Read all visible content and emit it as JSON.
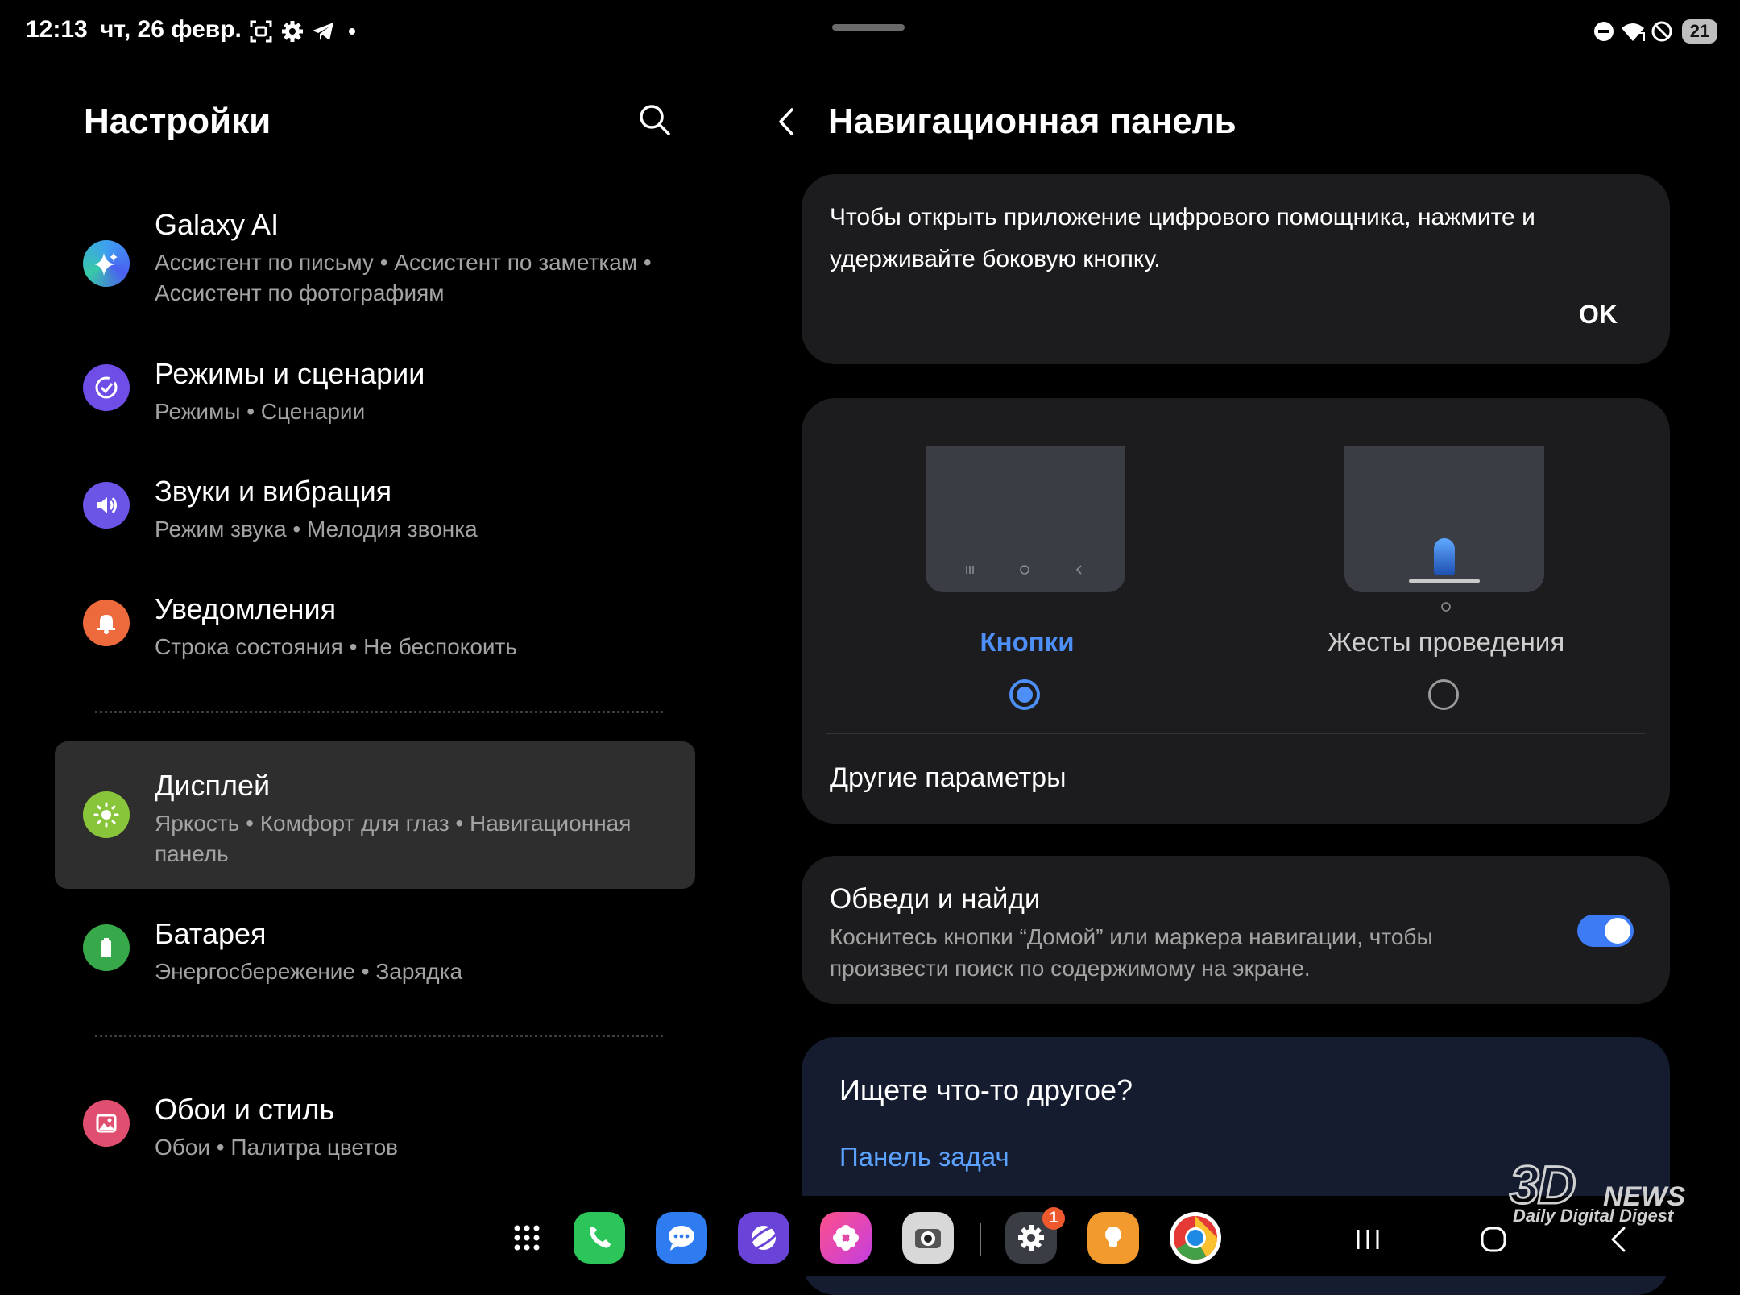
{
  "status_bar": {
    "time": "12:13",
    "date": "чт, 26 февр.",
    "left_icons": [
      "screenshot-icon",
      "settings-gear-icon",
      "telegram-icon",
      "dot-icon"
    ],
    "right_icons": [
      "do-not-disturb-icon",
      "wifi-icon",
      "no-sim-icon"
    ],
    "battery_level": "21"
  },
  "left_panel": {
    "title": "Настройки",
    "items": [
      {
        "title": "Galaxy AI",
        "subtitle": "Ассистент по письму  •  Ассистент по заметкам  •  Ассистент по фотографиям",
        "icon": "galaxy-ai-icon",
        "color": "#3a7bd5"
      },
      {
        "title": "Режимы и сценарии",
        "subtitle": "Режимы  •  Сценарии",
        "icon": "modes-icon",
        "color": "#6f4ee8"
      },
      {
        "title": "Звуки и вибрация",
        "subtitle": "Режим звука  •  Мелодия звонка",
        "icon": "sound-icon",
        "color": "#6a55e6"
      },
      {
        "title": "Уведомления",
        "subtitle": "Строка состояния  •  Не беспокоить",
        "icon": "bell-icon",
        "color": "#ec6a3b"
      },
      {
        "title": "Дисплей",
        "subtitle": "Яркость  •  Комфорт для глаз  •  Навигационная панель",
        "icon": "sun-icon",
        "color": "#88c53a",
        "selected": true
      },
      {
        "title": "Батарея",
        "subtitle": "Энергосбережение  •  Зарядка",
        "icon": "battery-icon",
        "color": "#37a94a"
      },
      {
        "title": "Обои и стиль",
        "subtitle": "Обои  •  Палитра цветов",
        "icon": "wallpaper-icon",
        "color": "#e14f70"
      }
    ]
  },
  "right_panel": {
    "title": "Навигационная панель",
    "info_text": "Чтобы открыть приложение цифрового помощника, нажмите и удерживайте боковую кнопку.",
    "ok_label": "OK",
    "options": [
      {
        "label": "Кнопки",
        "selected": true
      },
      {
        "label": "Жесты проведения",
        "selected": false
      }
    ],
    "other_params": "Другие параметры",
    "circle_search": {
      "title": "Обведи и найди",
      "description": "Коснитесь кнопки “Домой” или маркера навигации, чтобы произвести поиск по содержимому на экране.",
      "enabled": true
    },
    "suggest": {
      "title": "Ищете что-то другое?",
      "link": "Панель задач"
    }
  },
  "taskbar": {
    "apps": [
      "apps-grid-icon",
      "phone-icon",
      "messages-icon",
      "browser-icon",
      "gallery-icon",
      "camera-icon",
      "settings-icon",
      "tips-icon",
      "chrome-icon"
    ],
    "settings_badge": "1",
    "nav": [
      "recents-icon",
      "home-icon",
      "back-icon"
    ]
  },
  "watermark": {
    "logo": "3D",
    "news": "NEWS",
    "tagline": "Daily Digital Digest"
  }
}
